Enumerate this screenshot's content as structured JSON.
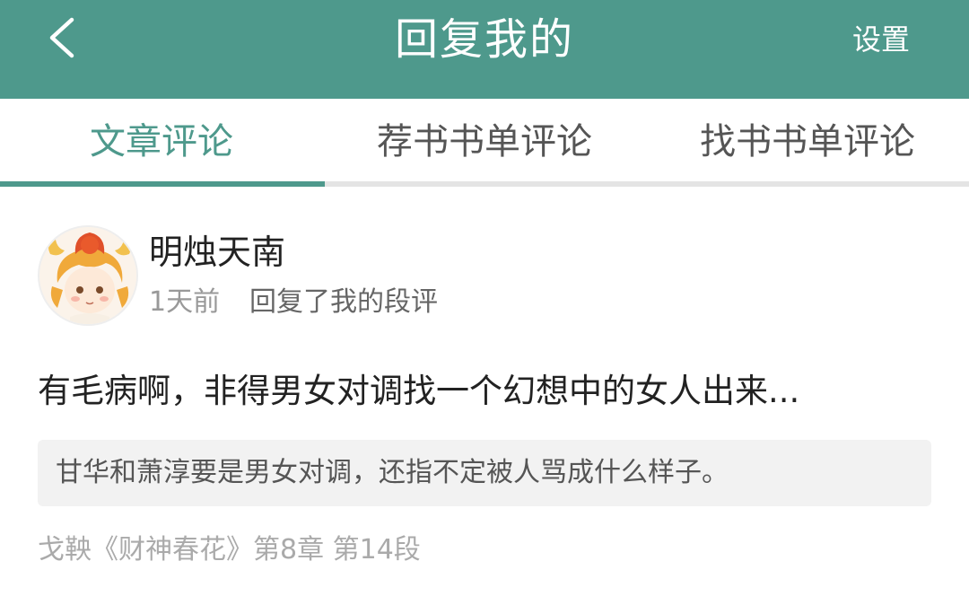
{
  "header": {
    "title": "回复我的",
    "settings_label": "设置",
    "back_icon": "chevron-left-icon",
    "background_color": "#4e998c"
  },
  "tabs": [
    {
      "label": "文章评论",
      "active": true
    },
    {
      "label": "荐书书单评论",
      "active": false
    },
    {
      "label": "找书书单评论",
      "active": false
    }
  ],
  "colors": {
    "accent": "#4e998c",
    "tab_track": "#e4e4e4",
    "quote_bg": "#f2f2f2"
  },
  "reply": {
    "username": "明烛天南",
    "time": "1天前",
    "action": "回复了我的段评",
    "text": "有毛病啊，非得男女对调找一个幻想中的女人出来...",
    "quoted_comment": "甘华和萧淳要是男女对调，还指不定被人骂成什么样子。",
    "source": "戈鞅《财神春花》第8章 第14段"
  }
}
